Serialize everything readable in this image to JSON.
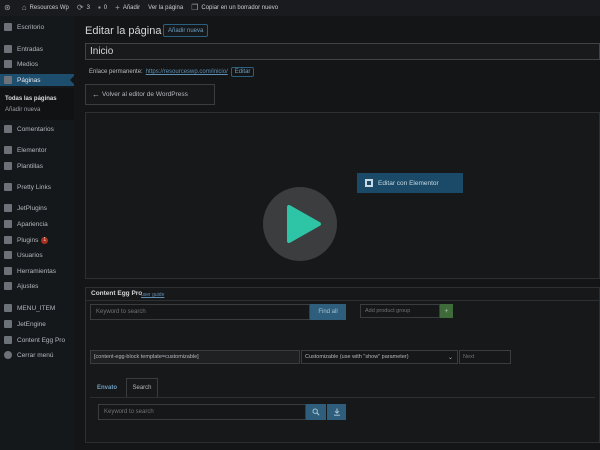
{
  "adminbar": {
    "site_name": "Resources Wp",
    "updates_count": "3",
    "comments_count": "0",
    "new_label": "Añadir",
    "view_page": "Ver la página",
    "copy_draft": "Copiar en un borrador nuevo"
  },
  "sidebar": {
    "items": [
      {
        "label": "Escritorio",
        "icon": "dashboard-icon"
      },
      {
        "label": "Entradas",
        "icon": "pin-icon"
      },
      {
        "label": "Medios",
        "icon": "media-icon"
      },
      {
        "label": "Páginas",
        "icon": "pages-icon",
        "current": true
      },
      {
        "label": "Comentarios",
        "icon": "comment-icon"
      },
      {
        "label": "Elementor",
        "icon": "elementor-icon"
      },
      {
        "label": "Plantillas",
        "icon": "templates-icon"
      },
      {
        "label": "Pretty Links",
        "icon": "star-icon"
      },
      {
        "label": "JetPlugins",
        "icon": "jetplugins-icon"
      },
      {
        "label": "Apariencia",
        "icon": "appearance-icon"
      },
      {
        "label": "Plugins",
        "icon": "plugins-icon",
        "badge": "1"
      },
      {
        "label": "Usuarios",
        "icon": "users-icon"
      },
      {
        "label": "Herramientas",
        "icon": "tools-icon"
      },
      {
        "label": "Ajustes",
        "icon": "settings-icon"
      },
      {
        "label": "MENU_ITEM",
        "icon": "menu-item-icon"
      },
      {
        "label": "JetEngine",
        "icon": "jetengine-icon"
      },
      {
        "label": "Content Egg Pro",
        "icon": "egg-icon"
      },
      {
        "label": "Cerrar menú",
        "icon": "collapse-icon"
      }
    ],
    "submenu": [
      "Todas las páginas",
      "Añadir nueva"
    ]
  },
  "main": {
    "page_title": "Editar la página",
    "add_new": "Añadir nueva",
    "title_value": "Inicio",
    "permalink_label": "Enlace permanente:",
    "permalink_url": "https://resourceswp.com/inicio/",
    "edit_label": "Editar",
    "back_button": "Volver al editor de WordPress",
    "elementor_button": "Editar con Elementor"
  },
  "content_egg": {
    "title": "Content Egg Pro",
    "user_guide": "user guide",
    "keyword_placeholder": "Keyword to search",
    "find_all": "Find all",
    "product_group_placeholder": "Add product group",
    "plus": "+",
    "template_value": "[content-egg-block template=customizable]",
    "customizable_option": "Customizable (use with \"show\" parameter)",
    "next_placeholder": "Next",
    "tabs": [
      "Envato",
      "Search"
    ],
    "search_placeholder": "Keyword to search"
  },
  "colors": {
    "accent": "#2e5e7b",
    "play_icon": "#2ec4a6"
  }
}
